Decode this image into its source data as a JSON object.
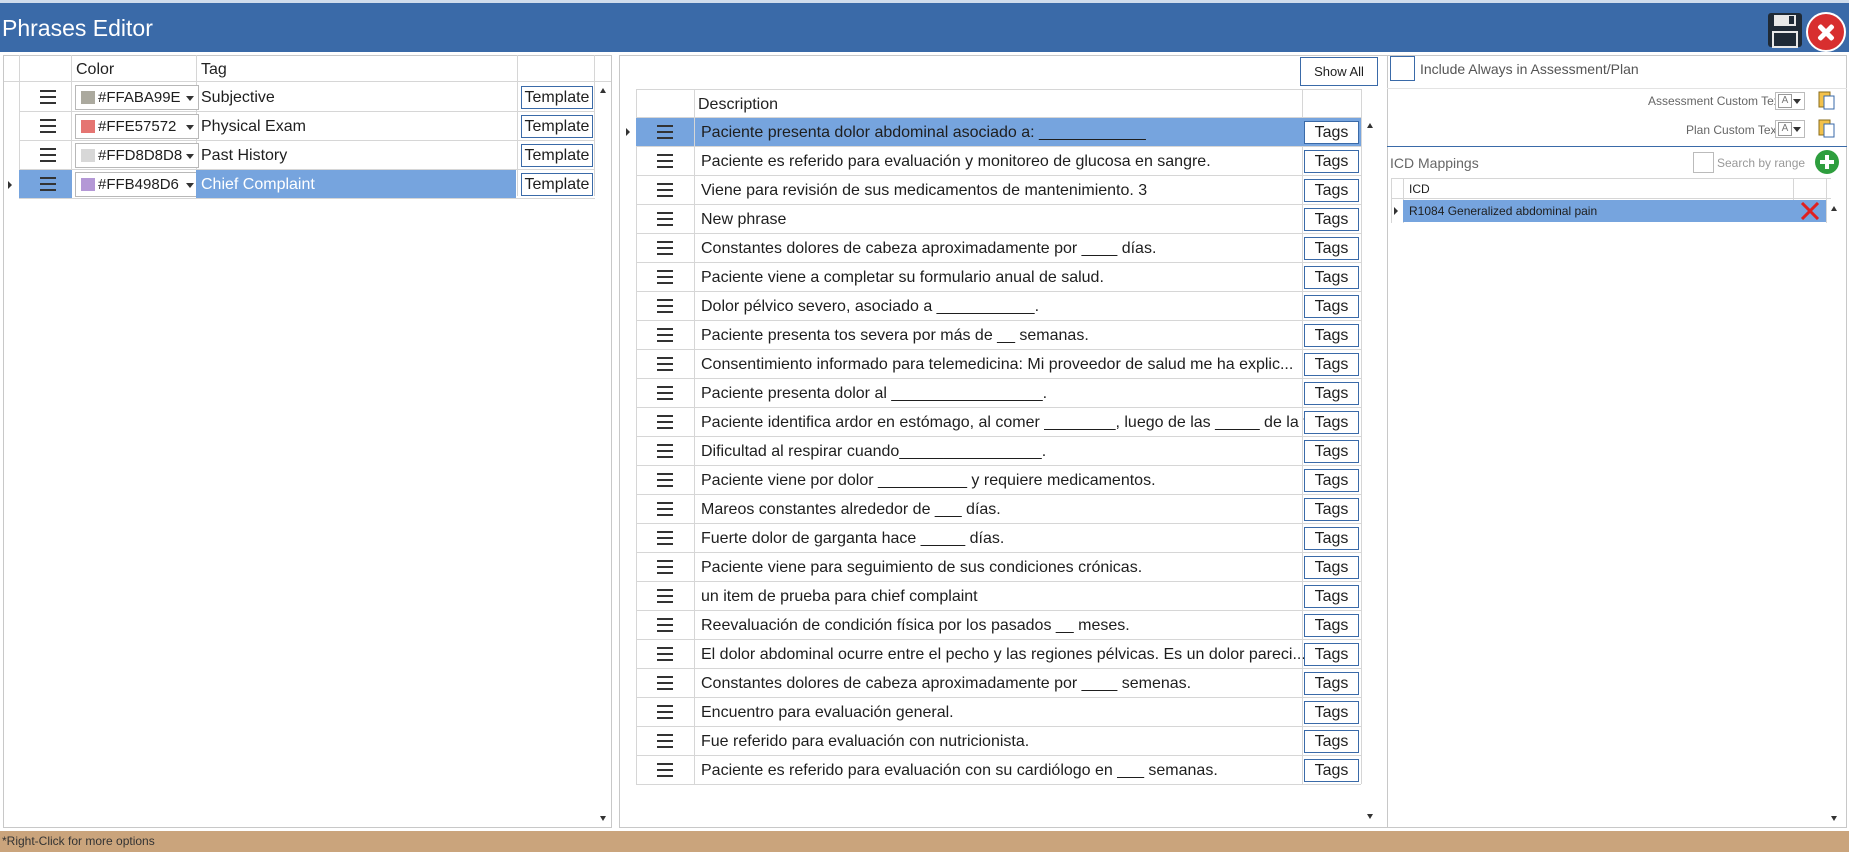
{
  "window": {
    "title": "Phrases Editor"
  },
  "tags_grid": {
    "headers": {
      "color": "Color",
      "tag": "Tag"
    },
    "rows": [
      {
        "color": "#FFABA99E",
        "swatch": "#ABA99E",
        "tag": "Subjective",
        "button": "Template",
        "selected": false
      },
      {
        "color": "#FFE57572",
        "swatch": "#E57572",
        "tag": "Physical Exam",
        "button": "Template",
        "selected": false
      },
      {
        "color": "#FFD8D8D8",
        "swatch": "#D8D8D8",
        "tag": "Past History",
        "button": "Template",
        "selected": false
      },
      {
        "color": "#FFB498D6",
        "swatch": "#B498D6",
        "tag": "Chief Complaint",
        "button": "Template",
        "selected": true
      }
    ]
  },
  "phrases_grid": {
    "show_all_label": "Show All",
    "header": "Description",
    "tags_label": "Tags",
    "rows": [
      "Paciente presenta dolor abdominal asociado a: ____________",
      "Paciente es referido para evaluación y monitoreo de glucosa en sangre.",
      "Viene para revisión de sus medicamentos de mantenimiento. 3",
      "New phrase",
      "Constantes dolores de cabeza aproximadamente por ____ días.",
      "Paciente viene a completar su formulario anual de salud.",
      "Dolor pélvico severo, asociado a ___________.",
      "Paciente presenta tos severa por más de __ semanas.",
      "Consentimiento informado para telemedicina:  Mi proveedor de salud me ha explic...",
      "Paciente presenta dolor al _________________.",
      "Paciente identifica ardor en estómago, al comer ________, luego de las _____ de la t...",
      "Dificultad al respirar cuando________________.",
      "Paciente viene por dolor __________ y requiere medicamentos.",
      "Mareos constantes alrededor de ___ días.",
      "Fuerte dolor de garganta hace _____ días.",
      "Paciente viene para seguimiento de sus condiciones crónicas.",
      "un item de prueba para chief complaint",
      "Reevaluación de condición física por los pasados __ meses.",
      "El dolor abdominal ocurre entre el pecho y las regiones pélvicas. Es un dolor pareci...",
      "Constantes dolores de cabeza aproximadamente por ____ semenas.",
      "Encuentro para evaluación general.",
      "Fue referido para evaluación con nutricionista.",
      "Paciente es referido para evaluación con su cardiólogo en ___ semanas."
    ],
    "selected_index": 0
  },
  "right_panel": {
    "include_always_label": "Include Always in Assessment/Plan",
    "assessment_custom_text_label": "Assessment Custom Text:",
    "plan_custom_text_label": "Plan Custom Text:",
    "icd_mappings_label": "ICD Mappings",
    "search_by_range_label": "Search by range",
    "icd_header": "ICD",
    "icd_rows": [
      "R1084 Generalized abdominal pain"
    ]
  },
  "status_bar": {
    "text": "*Right-Click for more options"
  },
  "colors": {
    "titlebar": "#3a6aa8",
    "selection": "#76a4de",
    "statusbar": "#caa47c",
    "close": "#d82f2f",
    "add": "#2e9e3e"
  }
}
